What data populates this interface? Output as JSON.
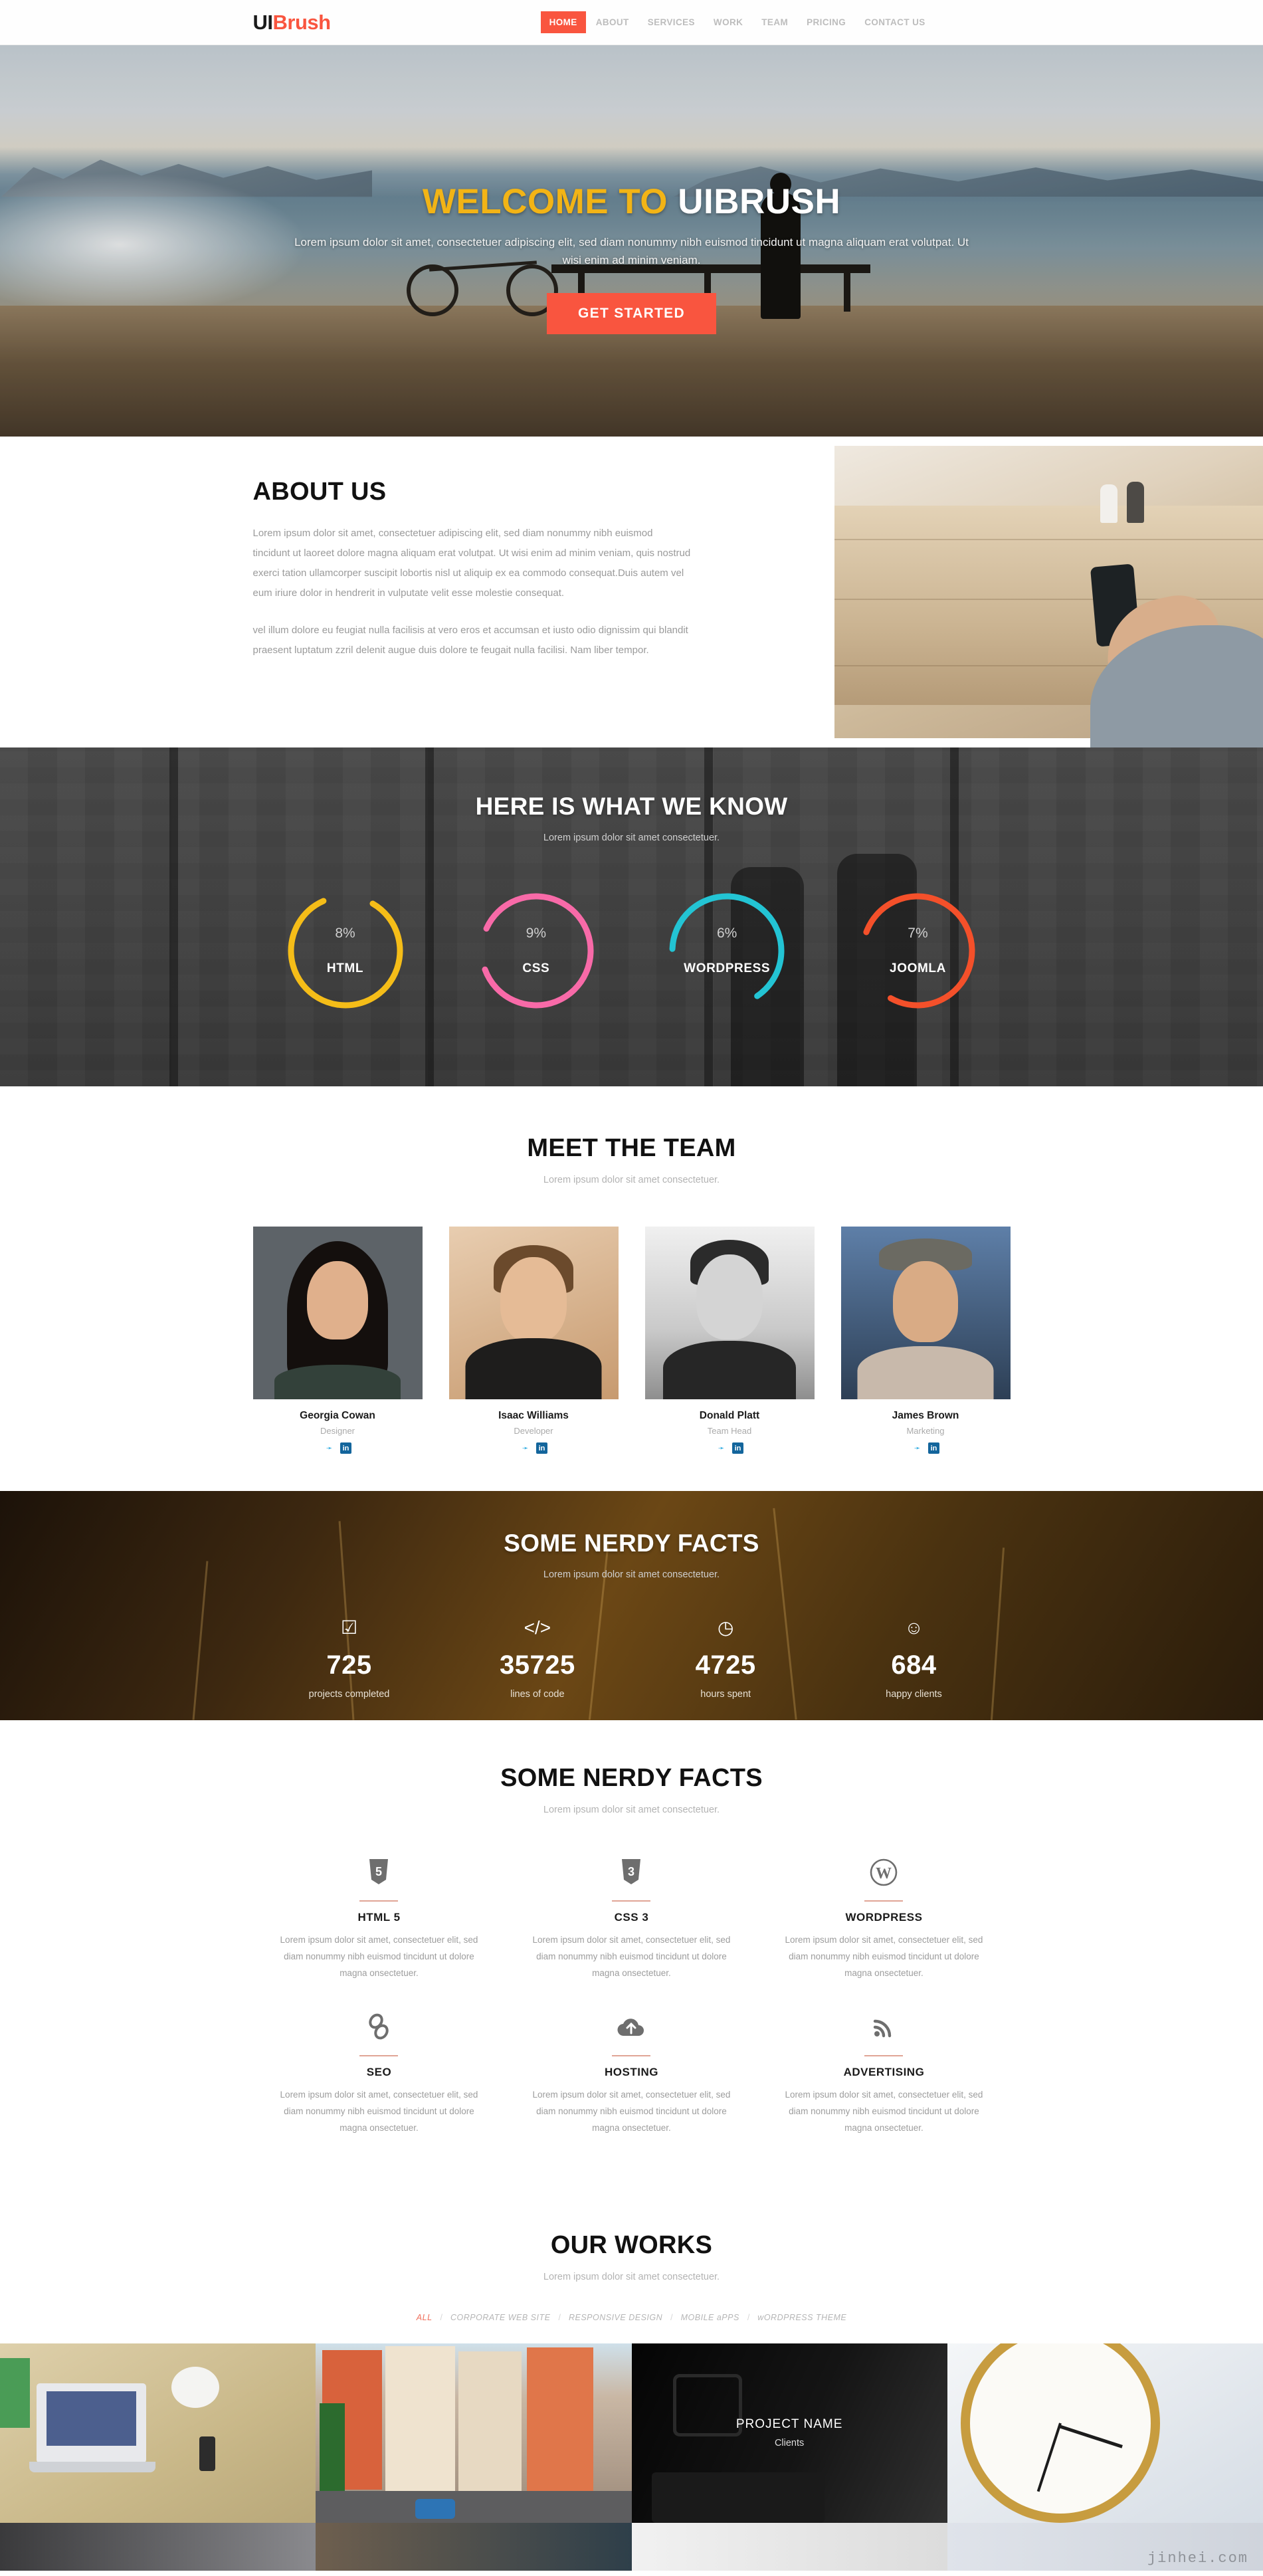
{
  "header": {
    "logo_part1": "UI",
    "logo_part2": "Brush",
    "nav": [
      {
        "label": "HOME",
        "active": true
      },
      {
        "label": "ABOUT",
        "active": false
      },
      {
        "label": "SERVICES",
        "active": false
      },
      {
        "label": "WORK",
        "active": false
      },
      {
        "label": "TEAM",
        "active": false
      },
      {
        "label": "PRICING",
        "active": false
      },
      {
        "label": "CONTACT US",
        "active": false
      }
    ]
  },
  "hero": {
    "title_highlight": "WELCOME TO",
    "title_rest": "UIBRUSH",
    "subtitle": "Lorem ipsum dolor sit amet, consectetuer adipiscing elit, sed diam nonummy nibh euismod tincidunt ut magna aliquam erat volutpat. Ut wisi enim ad minim veniam.",
    "cta_label": "GET STARTED",
    "cta_color": "#f9553f",
    "highlight_color": "#f2b416"
  },
  "about": {
    "title": "ABOUT US",
    "paragraph1": "Lorem ipsum dolor sit amet, consectetuer adipiscing elit, sed diam nonummy nibh euismod tincidunt ut laoreet dolore magna aliquam erat volutpat. Ut wisi enim ad minim veniam, quis nostrud exerci tation ullamcorper suscipit lobortis nisl ut aliquip ex ea commodo consequat.Duis autem vel eum iriure dolor in hendrerit in vulputate velit esse molestie consequat.",
    "paragraph2": "vel illum dolore eu feugiat nulla facilisis at vero eros et accumsan et iusto odio dignissim qui blandit praesent luptatum zzril delenit augue duis dolore te feugait nulla facilisi. Nam liber tempor."
  },
  "skills": {
    "title": "HERE IS WHAT WE KNOW",
    "subtitle": "Lorem ipsum dolor sit amet consectetuer.",
    "items": [
      {
        "name": "HTML",
        "percent": "8%",
        "value": 8,
        "color": "#f5bd18"
      },
      {
        "name": "CSS",
        "percent": "9%",
        "value": 9,
        "color": "#f86aa8"
      },
      {
        "name": "WORDPRESS",
        "percent": "6%",
        "value": 6,
        "color": "#23c4d4"
      },
      {
        "name": "JOOMLA",
        "percent": "7%",
        "value": 7,
        "color": "#f4502a"
      }
    ]
  },
  "team": {
    "title": "MEET THE TEAM",
    "subtitle": "Lorem ipsum dolor sit amet consectetuer.",
    "social": {
      "twitter": "twitter-icon",
      "linkedin": "in"
    },
    "members": [
      {
        "name": "Georgia Cowan",
        "role": "Designer"
      },
      {
        "name": "Isaac Williams",
        "role": "Developer"
      },
      {
        "name": "Donald Platt",
        "role": "Team Head"
      },
      {
        "name": "James Brown",
        "role": "Marketing"
      }
    ]
  },
  "facts": {
    "title": "SOME NERDY FACTS",
    "subtitle": "Lorem ipsum dolor sit amet consectetuer.",
    "items": [
      {
        "icon": "☑",
        "icon_name": "check-box-icon",
        "number": "725",
        "label": "projects completed"
      },
      {
        "icon": "</>",
        "icon_name": "code-icon",
        "number": "35725",
        "label": "lines of code"
      },
      {
        "icon": "◷",
        "icon_name": "clock-icon",
        "number": "4725",
        "label": "hours spent"
      },
      {
        "icon": "☺",
        "icon_name": "smiley-icon",
        "number": "684",
        "label": "happy clients"
      }
    ]
  },
  "services": {
    "title": "SOME NERDY FACTS",
    "subtitle": "Lorem ipsum dolor sit amet consectetuer.",
    "body": "Lorem ipsum dolor sit amet, consectetuer elit, sed diam nonummy nibh euismod tincidunt ut dolore magna onsectetuer.",
    "items": [
      {
        "title": "HTML 5",
        "icon_name": "html5-shield-icon"
      },
      {
        "title": "CSS 3",
        "icon_name": "css3-shield-icon"
      },
      {
        "title": "WORDPRESS",
        "icon_name": "wordpress-icon"
      },
      {
        "title": "SEO",
        "icon_name": "chain-link-icon"
      },
      {
        "title": "HOSTING",
        "icon_name": "cloud-upload-icon"
      },
      {
        "title": "ADVERTISING",
        "icon_name": "rss-feed-icon"
      }
    ]
  },
  "works": {
    "title": "OUR WORKS",
    "subtitle": "Lorem ipsum dolor sit amet consectetuer.",
    "filters": [
      {
        "label": "ALL",
        "active": true
      },
      {
        "label": "CORPORATE WEB SITE",
        "active": false
      },
      {
        "label": "RESPONSIVE DESIGN",
        "active": false
      },
      {
        "label": "MOBILE aPPS",
        "active": false
      },
      {
        "label": "wORDPRESS THEME",
        "active": false
      }
    ],
    "separator": "/",
    "overlay": {
      "project_name": "PROJECT NAME",
      "client": "Clients"
    }
  },
  "watermark": "jinhei.com"
}
